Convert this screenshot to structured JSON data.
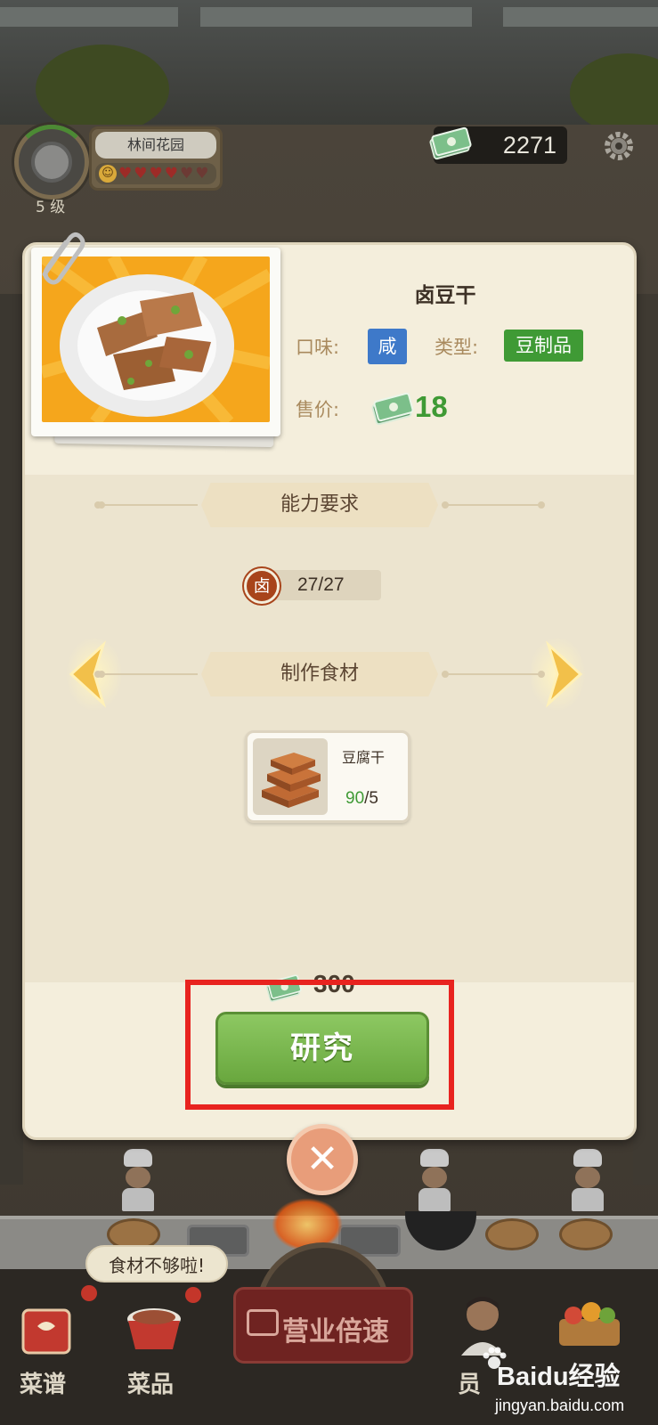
{
  "hud": {
    "restaurant_name": "林间花园",
    "level": "5 级",
    "money": "2271",
    "hearts_filled": 4,
    "hearts_total": 6
  },
  "dialog": {
    "dish_name": "卤豆干",
    "taste_label": "口味:",
    "taste_value": "咸",
    "type_label": "类型:",
    "type_value": "豆制品",
    "price_label": "售价:",
    "price_value": "18",
    "ability_section": "能力要求",
    "skill_icon_char": "卤",
    "skill_value": "27/27",
    "material_section": "制作食材",
    "ingredient": {
      "name": "豆腐干",
      "have": "90",
      "need": "/5"
    },
    "cost": "300",
    "research_button": "研究"
  },
  "bottom": {
    "speech": "食材不够啦!",
    "nav_recipes": "菜谱",
    "nav_dishes": "菜品",
    "speed_button": "营业倍速",
    "nav_staff": "员"
  },
  "watermark": {
    "brand": "Baidu经验",
    "url": "jingyan.baidu.com"
  },
  "colors": {
    "taste_tag": "#3e79c9",
    "type_tag": "#3f9a35",
    "price_green": "#3f9a35",
    "research_green": "#7bb84f",
    "highlight_red": "#e8231f"
  }
}
